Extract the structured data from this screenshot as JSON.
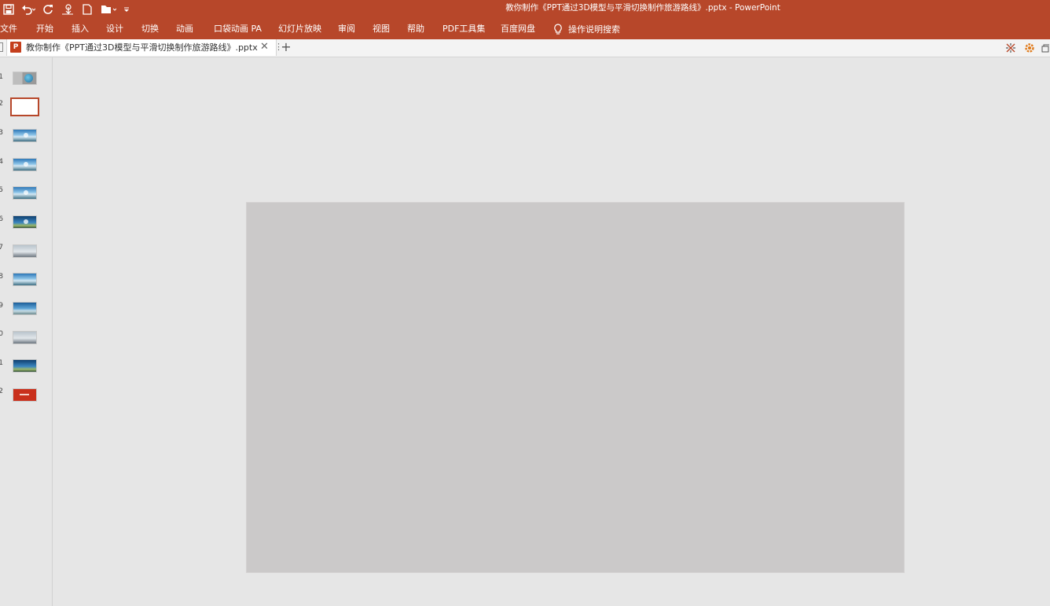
{
  "window": {
    "title": "教你制作《PPT通过3D模型与平滑切换制作旅游路线》.pptx  -  PowerPoint",
    "brand_color": "#b7472a"
  },
  "quick_access": [
    {
      "name": "save",
      "icon": "save-icon"
    },
    {
      "name": "undo",
      "icon": "undo-icon"
    },
    {
      "name": "redo",
      "icon": "redo-icon"
    },
    {
      "name": "touch-mode",
      "icon": "touch-mode-icon"
    },
    {
      "name": "new",
      "icon": "new-file-icon"
    },
    {
      "name": "open",
      "icon": "open-folder-icon"
    },
    {
      "name": "customize",
      "icon": "customize-qat-icon"
    }
  ],
  "ribbon": {
    "tabs": [
      "文件",
      "开始",
      "插入",
      "设计",
      "切换",
      "动画",
      "口袋动画 PA",
      "幻灯片放映",
      "审阅",
      "视图",
      "帮助",
      "PDF工具集",
      "百度网盘"
    ],
    "tell_me": "操作说明搜索"
  },
  "document_tab": {
    "name": "教你制作《PPT通过3D模型与平滑切换制作旅游路线》.pptx",
    "app_badge": "P"
  },
  "slides": {
    "count": 12,
    "selected": 2,
    "numbers": [
      "1",
      "2",
      "3",
      "4",
      "5",
      "6",
      "7",
      "8",
      "9",
      "0",
      "1",
      "2"
    ],
    "thumbs": [
      "title-globe",
      "blank",
      "sky",
      "sky",
      "sky",
      "dark-sky",
      "grey-sky",
      "sky",
      "sky2",
      "grey",
      "dark",
      "red"
    ]
  },
  "canvas": {
    "slide_color": "#cbc9c9",
    "background_color": "#e6e6e6"
  }
}
